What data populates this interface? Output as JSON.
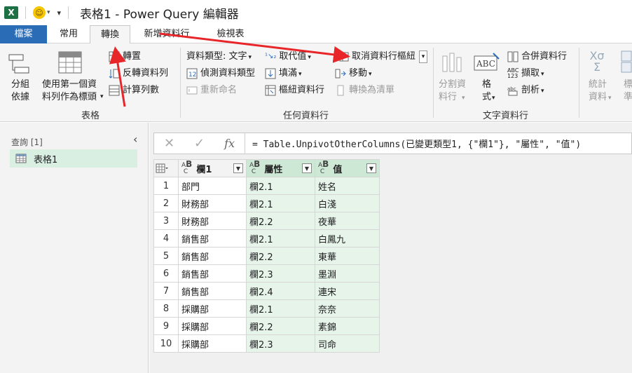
{
  "title": {
    "app_icon": "X",
    "doc_title": "表格1 - Power Query 編輯器"
  },
  "tabs": [
    "檔案",
    "常用",
    "轉換",
    "新增資料行",
    "檢視表"
  ],
  "ribbon": {
    "table_group": {
      "label": "表格",
      "group_by": "分組\n依據",
      "use_first_row": "使用第一個資\n料列作為標頭",
      "transpose": "轉置",
      "reverse_rows": "反轉資料列",
      "count_rows": "計算列數"
    },
    "any_column_group": {
      "label": "任何資料行",
      "data_type": "資料類型: 文字",
      "detect_type": "偵測資料類型",
      "rename": "重新命名",
      "replace_values": "取代值",
      "fill": "填滿",
      "pivot_column": "樞紐資料行",
      "unpivot_columns": "取消資料行樞紐",
      "move": "移動",
      "convert_to_list": "轉換為清單"
    },
    "text_column_group": {
      "label": "文字資料行",
      "split_column": "分割資\n料行",
      "format": "格\n式",
      "merge_columns": "合併資料行",
      "extract": "擷取",
      "parse": "剖析"
    },
    "number_group": {
      "statistics": "統計\n資料",
      "standard": "標\n準"
    }
  },
  "queries": {
    "header": "查詢 [1]",
    "items": [
      "表格1"
    ]
  },
  "formula": "= Table.UnpivotOtherColumns(已變更類型1, {\"欄1\"}, \"屬性\", \"值\")",
  "grid": {
    "columns": [
      "欄1",
      "屬性",
      "值"
    ],
    "rows": [
      [
        "部門",
        "欄2.1",
        "姓名"
      ],
      [
        "財務部",
        "欄2.1",
        "白淺"
      ],
      [
        "財務部",
        "欄2.2",
        "夜華"
      ],
      [
        "銷售部",
        "欄2.1",
        "白鳳九"
      ],
      [
        "銷售部",
        "欄2.2",
        "東華"
      ],
      [
        "銷售部",
        "欄2.3",
        "墨淵"
      ],
      [
        "銷售部",
        "欄2.4",
        "連宋"
      ],
      [
        "採購部",
        "欄2.1",
        "奈奈"
      ],
      [
        "採購部",
        "欄2.2",
        "素錦"
      ],
      [
        "採購部",
        "欄2.3",
        "司命"
      ]
    ]
  },
  "colors": {
    "file_tab": "#2b6cb6",
    "selected_header": "#cde8d5",
    "selected_cells": "#e6f4ea",
    "annotation_arrow": "#e8262a"
  }
}
